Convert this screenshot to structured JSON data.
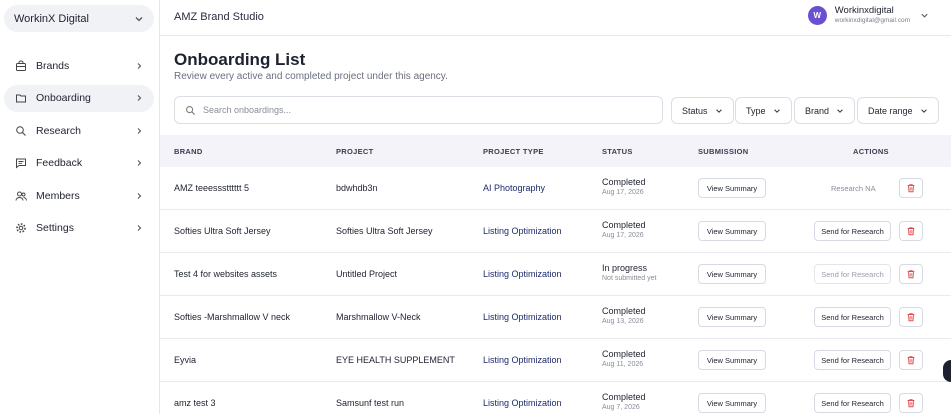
{
  "sidebar": {
    "workspace": "WorkinX Digital",
    "items": [
      {
        "label": "Brands",
        "icon": "bag-icon"
      },
      {
        "label": "Onboarding",
        "icon": "folder-icon"
      },
      {
        "label": "Research",
        "icon": "search-icon"
      },
      {
        "label": "Feedback",
        "icon": "chat-icon"
      },
      {
        "label": "Members",
        "icon": "users-icon"
      },
      {
        "label": "Settings",
        "icon": "gear-icon"
      }
    ],
    "active": "Onboarding"
  },
  "header": {
    "app_name": "AMZ Brand Studio",
    "user": {
      "initial": "W",
      "name": "Workinxdigital",
      "email": "workinxdigital@gmail.com"
    }
  },
  "page": {
    "title": "Onboarding List",
    "subtitle": "Review every active and completed project under this agency."
  },
  "search": {
    "placeholder": "Search onboardings..."
  },
  "filters": [
    "Status",
    "Type",
    "Brand",
    "Date range"
  ],
  "table": {
    "columns": [
      "BRAND",
      "PROJECT",
      "PROJECT TYPE",
      "STATUS",
      "SUBMISSION",
      "ACTIONS"
    ],
    "rows": [
      {
        "brand": "AMZ teeessstttttt 5",
        "project": "bdwhdb3n",
        "type": "AI Photography",
        "status": "Completed",
        "date": "Aug 17, 2026",
        "summary": "View Summary",
        "action": "Research NA"
      },
      {
        "brand": "Softies Ultra Soft Jersey",
        "project": "Softies Ultra Soft Jersey",
        "type": "Listing Optimization",
        "status": "Completed",
        "date": "Aug 17, 2026",
        "summary": "View Summary",
        "action": "Send for Research"
      },
      {
        "brand": "Test 4 for websites assets",
        "project": "Untitled Project",
        "type": "Listing Optimization",
        "status": "In progress",
        "date": "Not submitted yet",
        "summary": "View Summary",
        "action": "Send for Research"
      },
      {
        "brand": "Softies -Marshmallow V neck",
        "project": "Marshmallow V-Neck",
        "type": "Listing Optimization",
        "status": "Completed",
        "date": "Aug 13, 2026",
        "summary": "View Summary",
        "action": "Send for Research"
      },
      {
        "brand": "Eyvia",
        "project": "EYE HEALTH SUPPLEMENT",
        "type": "Listing Optimization",
        "status": "Completed",
        "date": "Aug 11, 2026",
        "summary": "View Summary",
        "action": "Send for Research"
      },
      {
        "brand": "amz test 3",
        "project": "Samsunf test run",
        "type": "Listing Optimization",
        "status": "Completed",
        "date": "Aug 7, 2026",
        "summary": "View Summary",
        "action": "Send for Research"
      }
    ]
  },
  "colors": {
    "accent": "#6a4fd1",
    "delete": "#e5484d",
    "header_bg": "#f3f3f9"
  }
}
